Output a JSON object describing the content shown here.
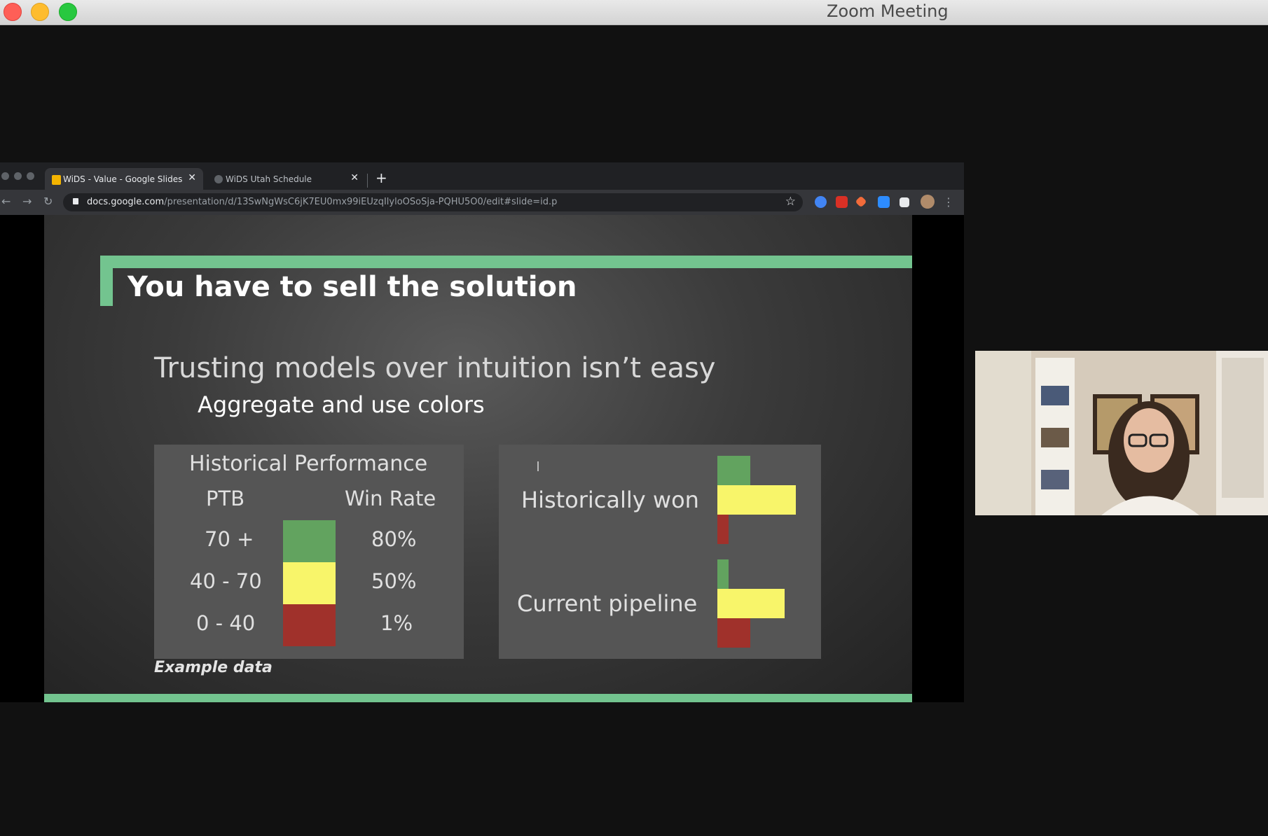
{
  "window": {
    "title": "Zoom Meeting"
  },
  "browser": {
    "tabs": [
      {
        "label": "WiDS - Value - Google Slides",
        "active": true
      },
      {
        "label": "WiDS Utah Schedule",
        "active": false
      }
    ],
    "url_host": "docs.google.com",
    "url_path": "/presentation/d/13SwNgWsC6jK7EU0mx99iEUzqIlyloOSoSja-PQHU5O0/edit#slide=id.p"
  },
  "slide": {
    "title": "You have to sell the solution",
    "subtitle": "Trusting models over intuition isn’t easy",
    "subpoint": "Aggregate and use colors",
    "note": "Example data",
    "table": {
      "title": "Historical Performance",
      "col_ptb": "PTB",
      "col_win": "Win Rate",
      "rows": [
        {
          "ptb": "70 +",
          "win": "80%",
          "color": "#62a35f"
        },
        {
          "ptb": "40 - 70",
          "win": "50%",
          "color": "#f8f56a"
        },
        {
          "ptb": "0 - 40",
          "win": "1%",
          "color": "#a0312b"
        }
      ]
    },
    "bars": {
      "label_historical": "Historically won",
      "label_current": "Current pipeline"
    }
  },
  "chart_data": {
    "type": "bar",
    "categories": [
      "Historically won",
      "Current pipeline"
    ],
    "series": [
      {
        "values": [
          0.42,
          0.14
        ],
        "color": "#62a35f"
      },
      {
        "values": [
          1.0,
          0.86
        ],
        "color": "#f8f56a"
      },
      {
        "values": [
          0.14,
          0.42
        ],
        "color": "#a0312b"
      }
    ],
    "xlabel": "",
    "ylabel": ""
  }
}
